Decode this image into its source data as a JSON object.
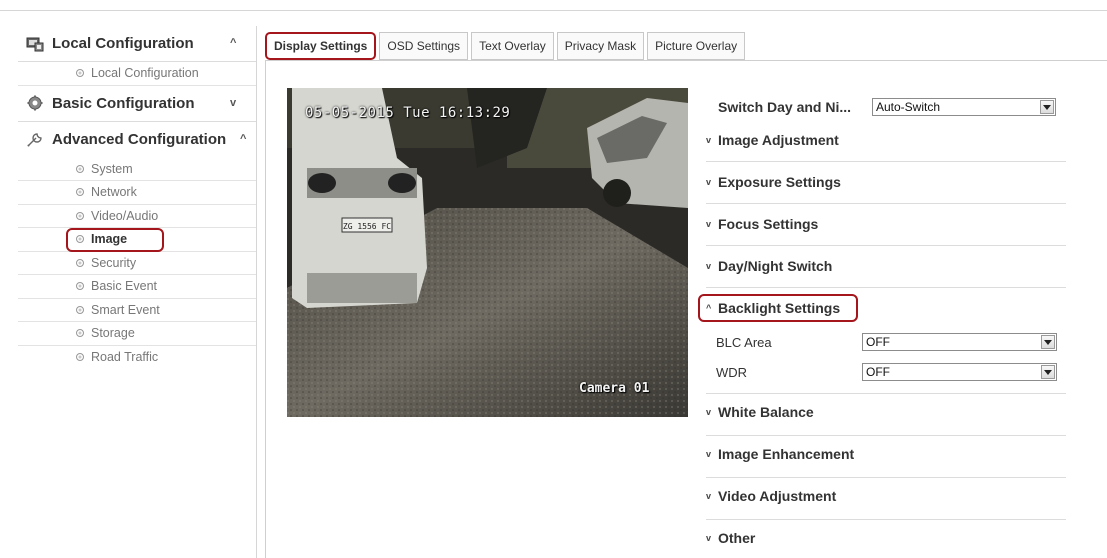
{
  "sidebar": {
    "groups": [
      {
        "label": "Local Configuration",
        "toggle": "^",
        "icon": "local-config-icon",
        "items": [
          {
            "label": "Local Configuration"
          }
        ]
      },
      {
        "label": "Basic Configuration",
        "toggle": "v",
        "icon": "gear-icon",
        "items": []
      },
      {
        "label": "Advanced Configuration",
        "toggle": "^",
        "icon": "wrench-icon",
        "items": [
          {
            "label": "System"
          },
          {
            "label": "Network"
          },
          {
            "label": "Video/Audio"
          },
          {
            "label": "Image",
            "active": true
          },
          {
            "label": "Security"
          },
          {
            "label": "Basic Event"
          },
          {
            "label": "Smart Event"
          },
          {
            "label": "Storage"
          },
          {
            "label": "Road Traffic"
          }
        ]
      }
    ]
  },
  "tabs": [
    {
      "label": "Display Settings",
      "active": true
    },
    {
      "label": "OSD Settings"
    },
    {
      "label": "Text Overlay"
    },
    {
      "label": "Privacy Mask"
    },
    {
      "label": "Picture Overlay"
    }
  ],
  "video": {
    "osd_time": "05-05-2015 Tue 16:13:29",
    "osd_camera": "Camera 01",
    "plate": "ZG 1556 FC"
  },
  "settings": {
    "switch_day_night": {
      "label": "Switch Day and Ni...",
      "value": "Auto-Switch"
    },
    "sections": {
      "image_adjustment": "Image Adjustment",
      "exposure": "Exposure Settings",
      "focus": "Focus Settings",
      "day_night": "Day/Night Switch",
      "backlight": "Backlight Settings",
      "white_balance": "White Balance",
      "image_enhancement": "Image Enhancement",
      "video_adjustment": "Video Adjustment",
      "other": "Other"
    },
    "collapsed_chevron": "v",
    "expanded_chevron": "^",
    "blc_area": {
      "label": "BLC Area",
      "value": "OFF"
    },
    "wdr": {
      "label": "WDR",
      "value": "OFF"
    }
  },
  "colors": {
    "highlight": "#a4151c"
  }
}
